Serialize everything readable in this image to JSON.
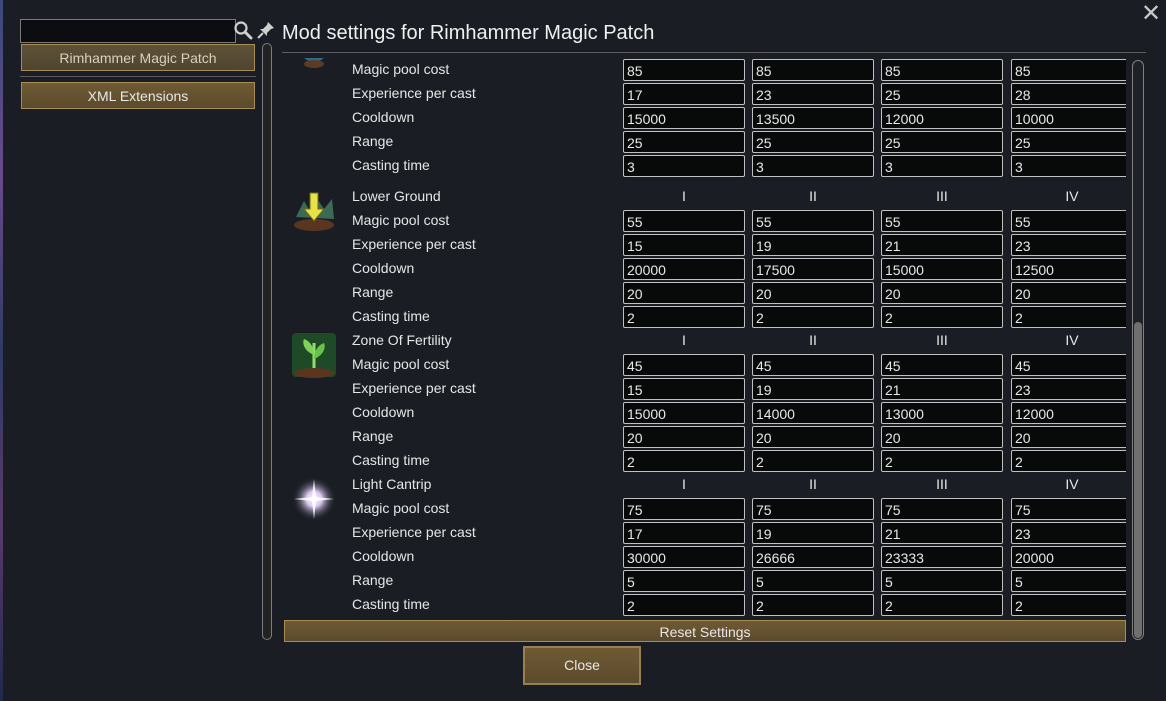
{
  "window": {
    "title": "Mod settings for Rimhammer Magic Patch",
    "close_glyph": "✕",
    "close_button": "Close",
    "reset_button": "Reset Settings"
  },
  "search": {
    "value": "",
    "placeholder": ""
  },
  "mod_list": [
    {
      "label": "Rimhammer Magic Patch",
      "selected": true
    },
    {
      "label": "XML Extensions",
      "selected": false
    }
  ],
  "level_headers": [
    "I",
    "II",
    "III",
    "IV"
  ],
  "stat_labels": [
    "Magic pool cost",
    "Experience per cast",
    "Cooldown",
    "Range",
    "Casting time"
  ],
  "spells": [
    {
      "name": "",
      "icon": "crystal-ball-icon",
      "values": [
        [
          "85",
          "85",
          "85",
          "85"
        ],
        [
          "17",
          "23",
          "25",
          "28"
        ],
        [
          "15000",
          "13500",
          "12000",
          "10000"
        ],
        [
          "25",
          "25",
          "25",
          "25"
        ],
        [
          "3",
          "3",
          "3",
          "3"
        ]
      ]
    },
    {
      "name": "Lower Ground",
      "icon": "lower-ground-icon",
      "values": [
        [
          "55",
          "55",
          "55",
          "55"
        ],
        [
          "15",
          "19",
          "21",
          "23"
        ],
        [
          "20000",
          "17500",
          "15000",
          "12500"
        ],
        [
          "20",
          "20",
          "20",
          "20"
        ],
        [
          "2",
          "2",
          "2",
          "2"
        ]
      ]
    },
    {
      "name": "Zone Of Fertility",
      "icon": "zone-of-fertility-icon",
      "values": [
        [
          "45",
          "45",
          "45",
          "45"
        ],
        [
          "15",
          "19",
          "21",
          "23"
        ],
        [
          "15000",
          "14000",
          "13000",
          "12000"
        ],
        [
          "20",
          "20",
          "20",
          "20"
        ],
        [
          "2",
          "2",
          "2",
          "2"
        ]
      ]
    },
    {
      "name": "Light Cantrip",
      "icon": "light-cantrip-icon",
      "values": [
        [
          "75",
          "75",
          "75",
          "75"
        ],
        [
          "17",
          "19",
          "21",
          "23"
        ],
        [
          "30000",
          "26666",
          "23333",
          "20000"
        ],
        [
          "5",
          "5",
          "5",
          "5"
        ],
        [
          "2",
          "2",
          "2",
          "2"
        ]
      ]
    }
  ],
  "colors": {
    "button_face": "#6e5a34",
    "button_border": "#a78d55",
    "field_bg": "#080909",
    "panel_bg": "#1a1e24"
  }
}
